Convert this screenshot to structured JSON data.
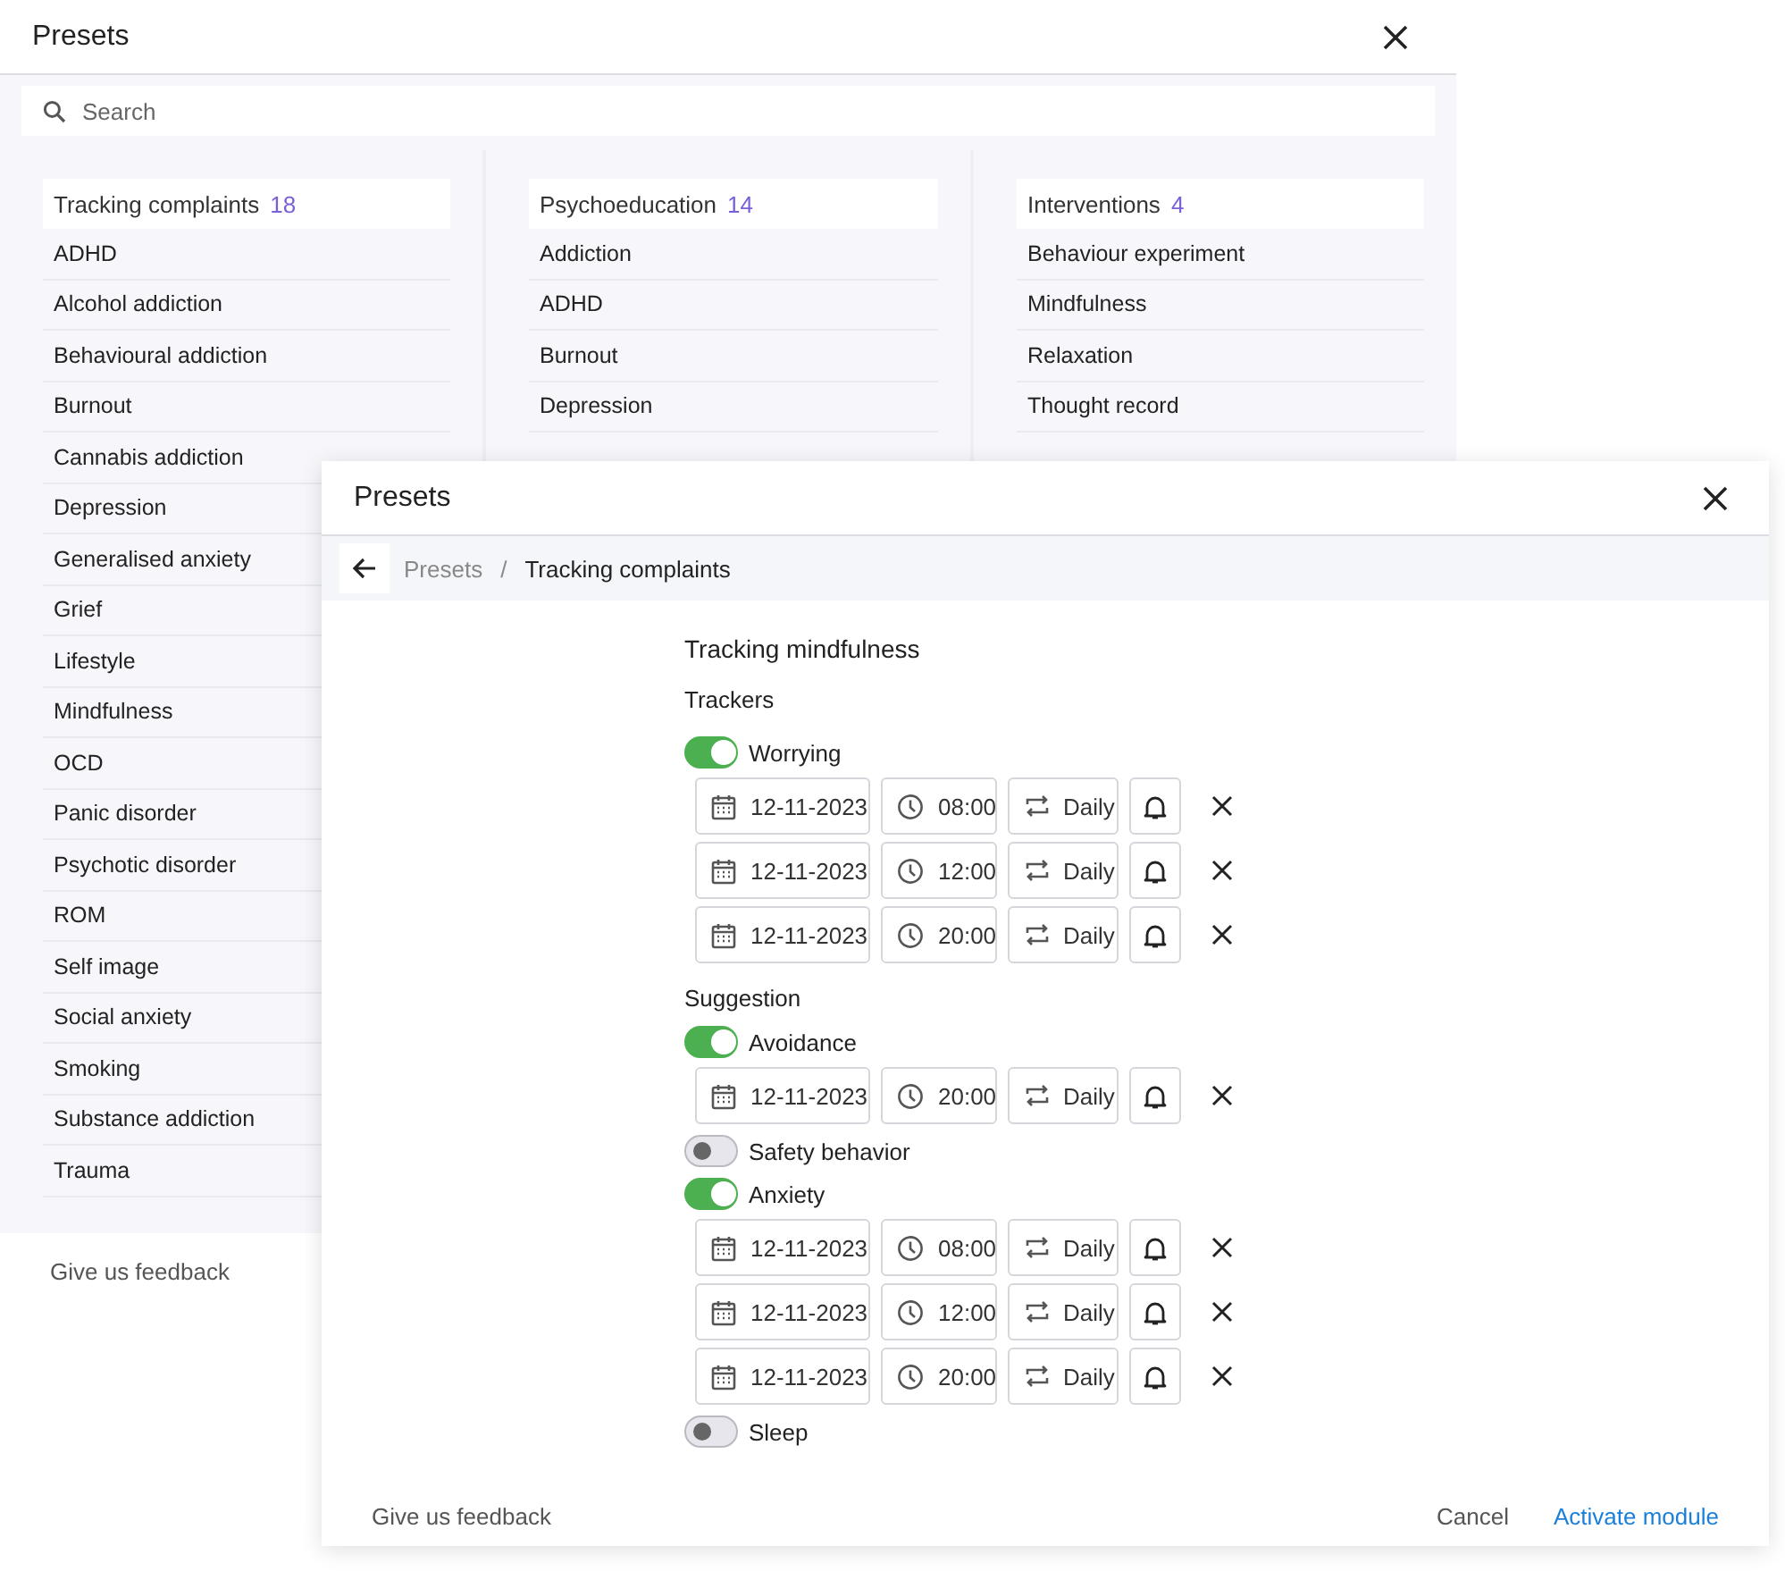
{
  "presets_window": {
    "title": "Presets",
    "search": {
      "placeholder": "Search"
    },
    "columns": [
      {
        "title": "Tracking complaints",
        "count": "18",
        "items": [
          "ADHD",
          "Alcohol addiction",
          "Behavioural addiction",
          "Burnout",
          "Cannabis addiction",
          "Depression",
          "Generalised anxiety",
          "Grief",
          "Lifestyle",
          "Mindfulness",
          "OCD",
          "Panic disorder",
          "Psychotic disorder",
          "ROM",
          "Self image",
          "Social anxiety",
          "Smoking",
          "Substance addiction",
          "Trauma"
        ]
      },
      {
        "title": "Psychoeducation",
        "count": "14",
        "items": [
          "Addiction",
          "ADHD",
          "Burnout",
          "Depression"
        ]
      },
      {
        "title": "Interventions",
        "count": "4",
        "items": [
          "Behaviour experiment",
          "Mindfulness",
          "Relaxation",
          "Thought record"
        ]
      }
    ],
    "feedback": "Give us feedback"
  },
  "module_dialog": {
    "title": "Presets",
    "breadcrumb": {
      "separator": "/",
      "items": [
        {
          "label": "Presets",
          "current": false
        },
        {
          "label": "Tracking complaints",
          "current": true
        }
      ]
    },
    "heading": "Tracking mindfulness",
    "sections": [
      {
        "title": "Trackers",
        "trackers": [
          {
            "label": "Worrying",
            "on": true,
            "schedules": [
              {
                "date": "12-11-2023",
                "time": "08:00",
                "repeat": "Daily"
              },
              {
                "date": "12-11-2023",
                "time": "12:00",
                "repeat": "Daily"
              },
              {
                "date": "12-11-2023",
                "time": "20:00",
                "repeat": "Daily"
              }
            ]
          }
        ]
      },
      {
        "title": "Suggestion",
        "trackers": [
          {
            "label": "Avoidance",
            "on": true,
            "schedules": [
              {
                "date": "12-11-2023",
                "time": "20:00",
                "repeat": "Daily"
              }
            ]
          },
          {
            "label": "Safety behavior",
            "on": false
          },
          {
            "label": "Anxiety",
            "on": true,
            "schedules": [
              {
                "date": "12-11-2023",
                "time": "08:00",
                "repeat": "Daily"
              },
              {
                "date": "12-11-2023",
                "time": "12:00",
                "repeat": "Daily"
              },
              {
                "date": "12-11-2023",
                "time": "20:00",
                "repeat": "Daily"
              }
            ]
          },
          {
            "label": "Sleep",
            "on": false
          }
        ]
      }
    ],
    "footer": {
      "feedback": "Give us feedback",
      "buttons": [
        {
          "label": "Cancel",
          "kind": "secondary"
        },
        {
          "label": "Activate module",
          "kind": "primary"
        }
      ]
    }
  }
}
